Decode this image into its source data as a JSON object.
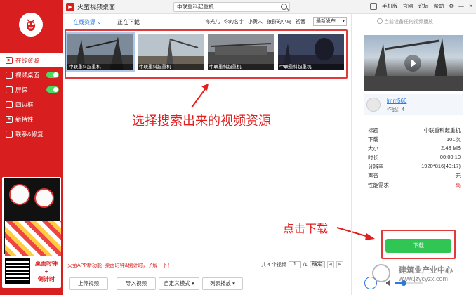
{
  "sidebar": {
    "nav": [
      {
        "label": "在线资源",
        "icon": "play-icon",
        "active": true
      },
      {
        "label": "视频桌面",
        "icon": "desktop-icon",
        "toggle": true
      },
      {
        "label": "屏保",
        "icon": "screensaver-icon",
        "toggle": true
      },
      {
        "label": "四边框",
        "icon": "frame-icon"
      },
      {
        "label": "新特性",
        "icon": "star-icon"
      },
      {
        "label": "联系&修复",
        "icon": "wrench-icon"
      }
    ],
    "promo": {
      "line1": "桌面时钟",
      "line2": "+",
      "line3": "倒计时"
    }
  },
  "titlebar": {
    "app_title": "火萤视频桌面",
    "search_value": "中联重科起重机",
    "links": [
      "手机版",
      "官网",
      "论坛",
      "帮助"
    ]
  },
  "filter": {
    "tab_online": "在线资源",
    "tab_download": "正在下载",
    "tags": [
      "祢光儿",
      "你的名字",
      "小黄人",
      "狼群的小鸟",
      "初音"
    ],
    "sort": "最新发布"
  },
  "results": [
    {
      "title": "中联重科起重机"
    },
    {
      "title": "中联重科起重机"
    },
    {
      "title": "中联重科起重机"
    },
    {
      "title": "中联重科起重机"
    }
  ],
  "annotations": {
    "select_hint": "选择搜索出来的视频资源",
    "download_hint": "点击下载"
  },
  "footer": {
    "notice": "火萤APP新功能--桌面时钟&倒计时，了解一下！",
    "pager_total": "共 4 个视频",
    "pager_page": "1",
    "pager_of": "/1",
    "pager_confirm": "确定",
    "buttons": [
      "上传视频",
      "导入视频",
      "自定义模式",
      "列表播放"
    ]
  },
  "panel": {
    "device_msg": "当前设备任何视频播放",
    "author": "lmm566",
    "works": "作品：4",
    "props": [
      {
        "k": "标题",
        "v": "中联重科起重机"
      },
      {
        "k": "下载",
        "v": "101次"
      },
      {
        "k": "大小",
        "v": "2.43 MB"
      },
      {
        "k": "时长",
        "v": "00:00:10"
      },
      {
        "k": "分辨率",
        "v": "1920*816(40:17)"
      },
      {
        "k": "声音",
        "v": "无"
      },
      {
        "k": "性能需求",
        "v": "高"
      }
    ],
    "download_label": "下载",
    "volume": 0.3
  },
  "watermark": {
    "title": "建筑业产业中心",
    "url": "www.jzycyzx.com"
  },
  "colors": {
    "brand": "#d81e1e",
    "accent": "#2a7ae2",
    "download": "#2fc653"
  }
}
